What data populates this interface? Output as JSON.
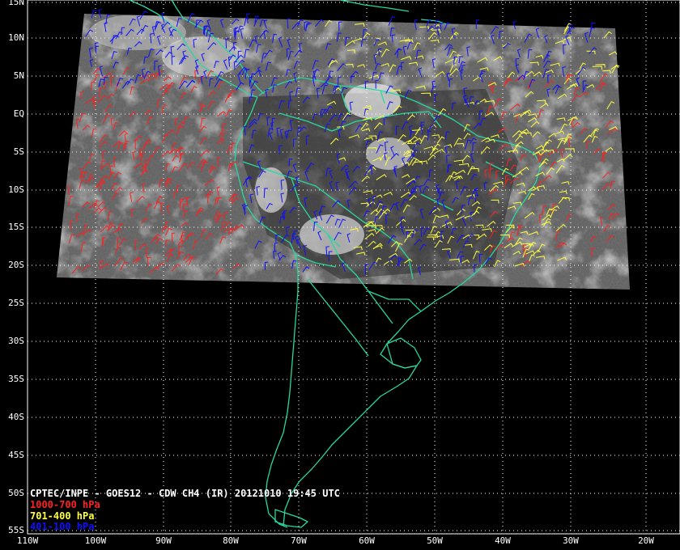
{
  "title": "CPTEC/INPE - GOES12 - CDW CH4 (IR) 20121010 19:45 UTC",
  "legend": [
    {
      "label": "1000-700 hPa",
      "color": "#ff2020"
    },
    {
      "label": "701-400 hPa",
      "color": "#ffff40"
    },
    {
      "label": "401-100 hPa",
      "color": "#1010ff"
    }
  ],
  "lat_labels": [
    "15N",
    "10N",
    "5N",
    "EQ",
    "5S",
    "10S",
    "15S",
    "20S",
    "25S",
    "30S",
    "35S",
    "40S",
    "45S",
    "50S",
    "55S"
  ],
  "lon_labels": [
    "110W",
    "100W",
    "90W",
    "80W",
    "70W",
    "60W",
    "50W",
    "40W",
    "30W",
    "20W"
  ],
  "colors": {
    "background": "#000000",
    "coastline": "#28d8a0",
    "grid": "#ffffff",
    "satellite_image": "#5a5a5a"
  }
}
